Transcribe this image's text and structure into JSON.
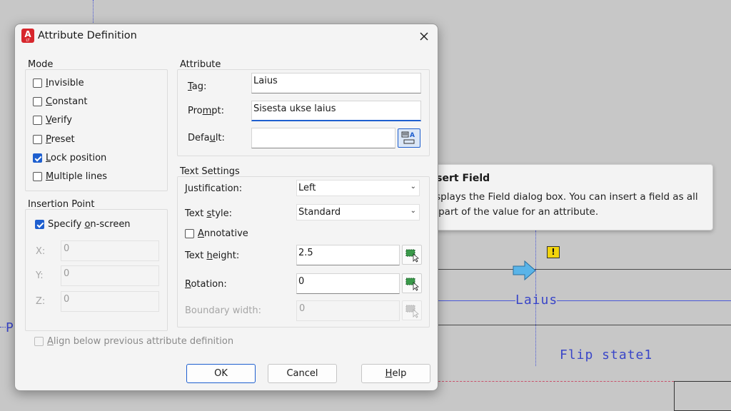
{
  "dialog": {
    "title": "Attribute Definition",
    "app_icon": {
      "letter": "A",
      "sub": "LT"
    },
    "close_icon": "close-icon"
  },
  "mode": {
    "label": "Mode",
    "options": [
      {
        "label": "Invisible",
        "access": "I",
        "rest": "nvisible",
        "checked": false
      },
      {
        "label": "Constant",
        "access": "C",
        "rest": "onstant",
        "checked": false
      },
      {
        "label": "Verify",
        "access": "V",
        "rest": "erify",
        "checked": false
      },
      {
        "label": "Preset",
        "access": "P",
        "rest": "reset",
        "checked": false
      },
      {
        "label": "Lock position",
        "access": "L",
        "rest": "ock position",
        "checked": true
      },
      {
        "label": "Multiple lines",
        "access": "M",
        "rest": "ultiple lines",
        "checked": false
      }
    ]
  },
  "insertion_point": {
    "label": "Insertion Point",
    "specify_on_screen": {
      "before": "Specify ",
      "access": "o",
      "after": "n-screen",
      "checked": true
    },
    "x": {
      "label": "X:",
      "value": "0"
    },
    "y": {
      "label": "Y:",
      "value": "0"
    },
    "z": {
      "label": "Z:",
      "value": "0"
    }
  },
  "attribute": {
    "label": "Attribute",
    "tag": {
      "access": "T",
      "rest": "ag:",
      "value": "Laius"
    },
    "prompt": {
      "before": "Pro",
      "access": "m",
      "after": "pt:",
      "value": "Sisesta ukse laius"
    },
    "default": {
      "before": "Defa",
      "access": "u",
      "after": "lt:",
      "value": ""
    }
  },
  "text_settings": {
    "label": "Text Settings",
    "justification": {
      "access": "J",
      "rest": "ustification:",
      "value": "Left"
    },
    "text_style": {
      "before": "Text ",
      "access": "s",
      "after": "tyle:",
      "value": "Standard"
    },
    "annotative": {
      "access": "A",
      "rest": "nnotative",
      "checked": false
    },
    "text_height": {
      "before": "Text ",
      "access": "h",
      "after": "eight:",
      "value": "2.5"
    },
    "rotation": {
      "access": "R",
      "rest": "otation:",
      "value": "0"
    },
    "boundary_width": {
      "label": "Boundary width:",
      "value": "0"
    }
  },
  "align_below": {
    "access": "A",
    "rest": "lign below previous attribute definition",
    "checked": false
  },
  "buttons": {
    "ok": "OK",
    "cancel": "Cancel",
    "help_access": "H",
    "help_rest": "elp"
  },
  "tooltip": {
    "title": "Insert Field",
    "body": "Displays the Field dialog box. You can insert a field as all or part of the value for an attribute."
  },
  "canvas": {
    "laius_text": "Laius",
    "flip_text": "Flip state1",
    "left_fragment": "P",
    "warning_symbol": "!"
  },
  "colors": {
    "accent": "#1e5fcf",
    "cad_blue": "#3a46c8",
    "warning": "#f2d40c",
    "grip": "#5ab4e8"
  }
}
